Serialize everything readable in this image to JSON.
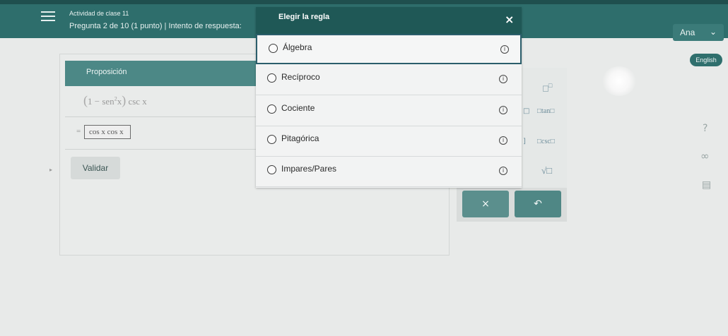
{
  "header": {
    "course_title": "Actividad de clase 11",
    "question_info": "Pregunta 2 de 10 (1 punto)  |  Intento de respuesta:",
    "user_name": "Ana",
    "user_chevron": "⌄",
    "language_button": "English"
  },
  "proposition": {
    "header": "Proposición",
    "row1": {
      "paren_open": "(",
      "one": "1",
      "minus": " − ",
      "sen": "sen",
      "exp": "2",
      "var": "x",
      "paren_close": ")",
      "func": " csc",
      "var2": " x"
    },
    "equals": "=",
    "expression": "cos x cos x",
    "validate_label": "Validar",
    "small_arrow": "▸"
  },
  "palette": {
    "key_power": "□",
    "key_power_sup": "□",
    "key_tan": "□tan□",
    "key_csc": "□csc□",
    "key_sqrt": "√□",
    "frag1": "□",
    "frag2": "]",
    "clear_label": "×",
    "undo_label": "↶"
  },
  "side": {
    "help": "?",
    "infinity": "∞",
    "doc": "▤"
  },
  "modal": {
    "title": "Elegir la regla",
    "close": "×",
    "info_glyph": "i",
    "options": [
      {
        "label": "Álgebra"
      },
      {
        "label": "Recíproco"
      },
      {
        "label": "Cociente"
      },
      {
        "label": "Pitagórica"
      },
      {
        "label": "Impares/Pares"
      }
    ]
  },
  "colors": {
    "header_bg": "#2e6e6c",
    "modal_header": "#1f5856",
    "accent": "#4c8886"
  }
}
